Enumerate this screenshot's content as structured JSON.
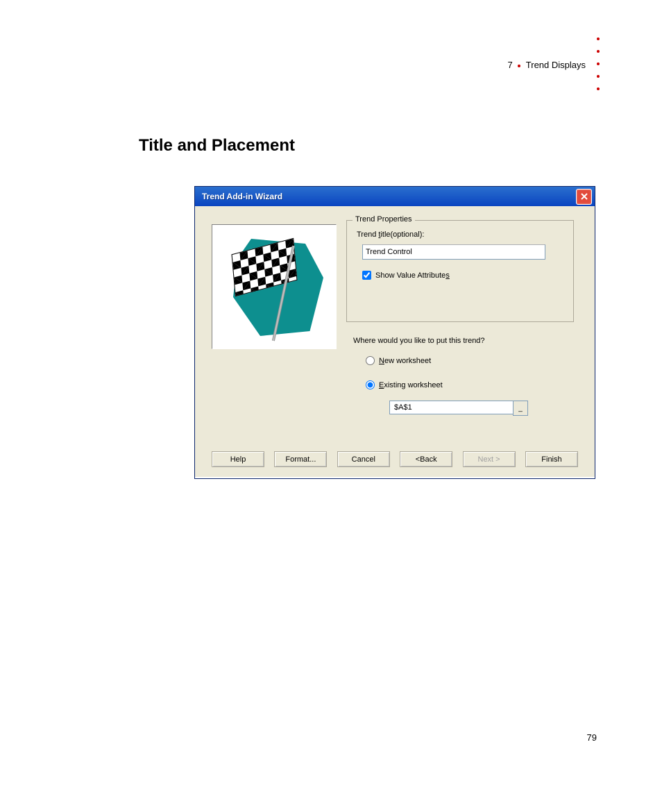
{
  "header": {
    "chapter_num": "7",
    "chapter_title": "Trend Displays"
  },
  "section_title": "Title and Placement",
  "dialog": {
    "title": "Trend Add-in Wizard",
    "fieldset_legend": "Trend Properties",
    "title_label_prefix": "Trend ",
    "title_label_u": "t",
    "title_label_suffix": "itle(optional):",
    "title_value": "Trend Control",
    "show_attrs_prefix": "Show Value Attribute",
    "show_attrs_u": "s",
    "placement_question": "Where would you like to put this trend?",
    "radio_new_u": "N",
    "radio_new_suffix": "ew worksheet",
    "radio_existing_u": "E",
    "radio_existing_suffix": "xisting worksheet",
    "cell_ref": "$A$1",
    "collapse_char": "_",
    "buttons": {
      "help": "Help",
      "format": "Format...",
      "cancel": "Cancel",
      "back": "<Back",
      "next": "Next >",
      "finish": "Finish"
    }
  },
  "page_number": "79"
}
